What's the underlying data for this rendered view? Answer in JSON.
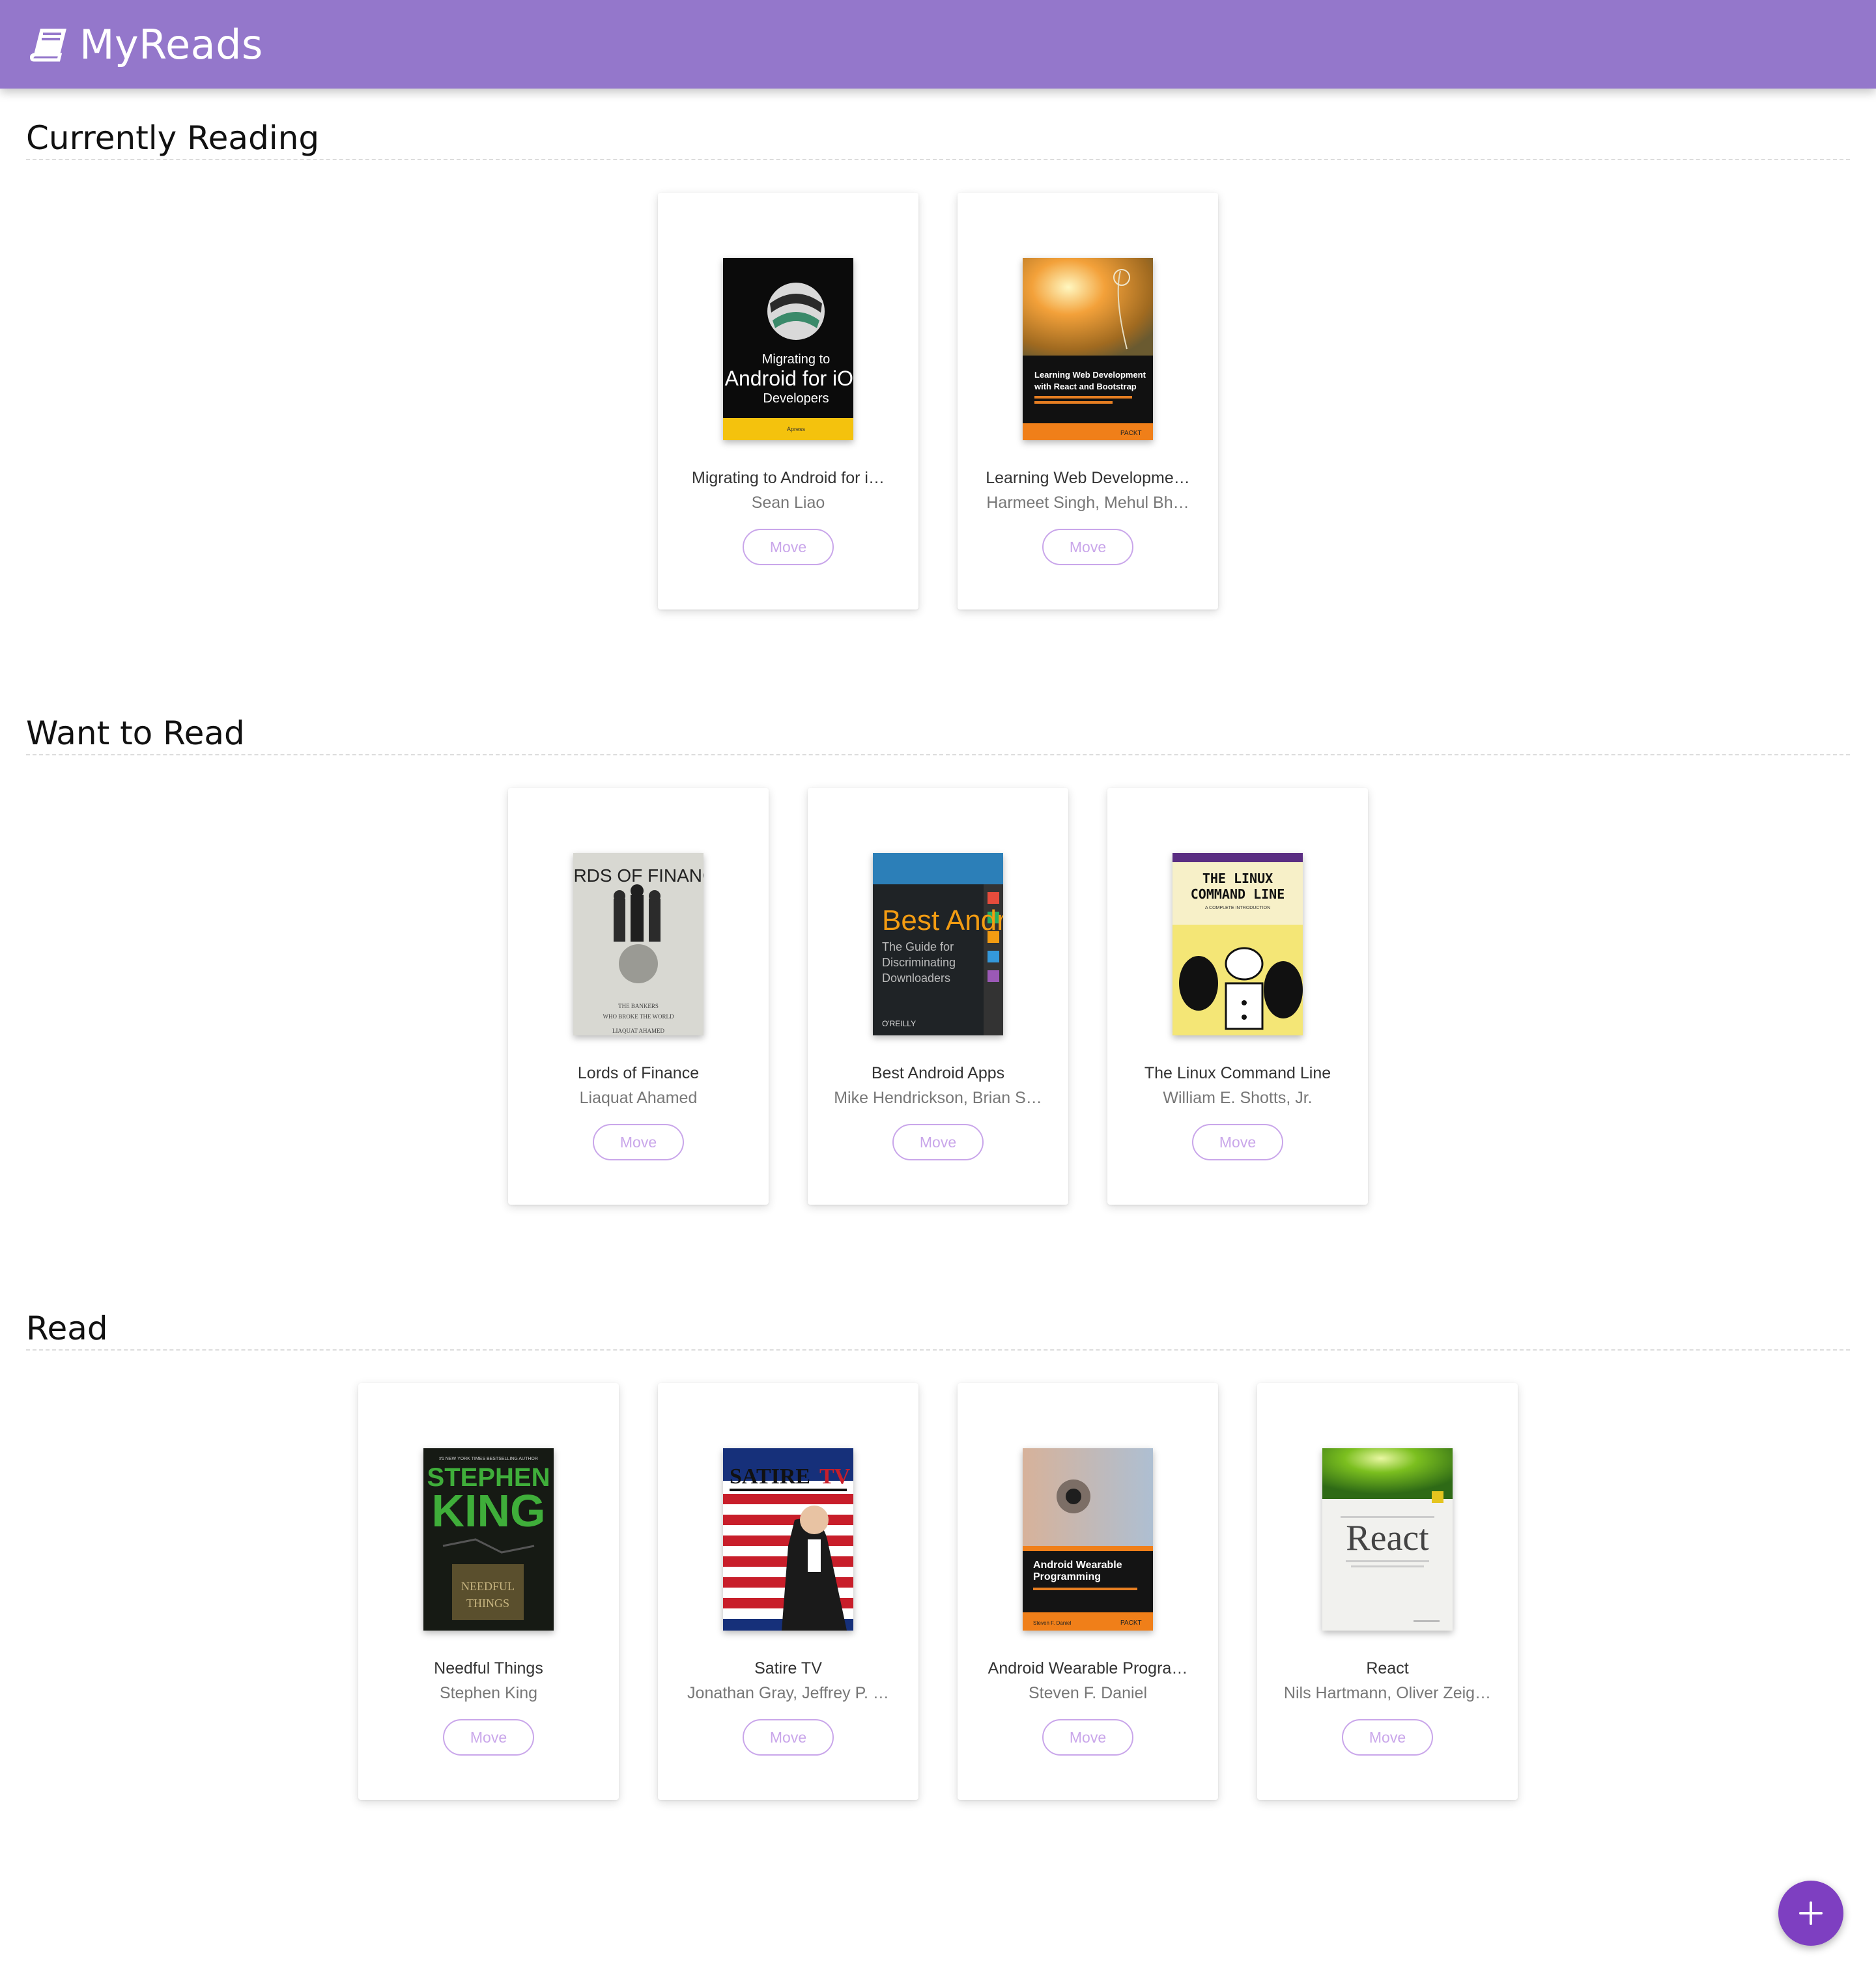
{
  "app": {
    "title": "MyReads",
    "logo_icon": "book-icon"
  },
  "colors": {
    "header": "#9477cb",
    "accent": "#7e3fc1",
    "move_button": "#c9a6ea"
  },
  "shelves": [
    {
      "title": "Currently Reading",
      "books": [
        {
          "title": "Migrating to Android for i…",
          "authors": "Sean Liao",
          "action": "Move"
        },
        {
          "title": "Learning Web Developme…",
          "authors": "Harmeet Singh, Mehul Bh…",
          "action": "Move"
        }
      ]
    },
    {
      "title": "Want to Read",
      "books": [
        {
          "title": "Lords of Finance",
          "authors": "Liaquat Ahamed",
          "action": "Move"
        },
        {
          "title": "Best Android Apps",
          "authors": "Mike Hendrickson, Brian S…",
          "action": "Move"
        },
        {
          "title": "The Linux Command Line",
          "authors": "William E. Shotts, Jr.",
          "action": "Move"
        }
      ]
    },
    {
      "title": "Read",
      "books": [
        {
          "title": "Needful Things",
          "authors": "Stephen King",
          "action": "Move"
        },
        {
          "title": "Satire TV",
          "authors": "Jonathan Gray, Jeffrey P. …",
          "action": "Move"
        },
        {
          "title": "Android Wearable Progra…",
          "authors": "Steven F. Daniel",
          "action": "Move"
        },
        {
          "title": "React",
          "authors": "Nils Hartmann, Oliver Zeig…",
          "action": "Move"
        }
      ]
    }
  ],
  "covers": {
    "c1": {
      "line1": "Migrating to",
      "line2": "Android for iOS",
      "line3": "Developers",
      "publisher": "Apress"
    },
    "c2": {
      "line1": "Learning Web Development",
      "line2": "with React and Bootstrap",
      "publisher": "PACKT"
    },
    "c3": {
      "line1": "LORDS OF FINANCE",
      "line2": "THE BANKERS",
      "line3": "WHO BROKE THE WORLD",
      "line4": "LIAQUAT AHAMED"
    },
    "c4": {
      "line1": "Best Andr",
      "line2": "The Guide for",
      "line3": "Discriminating",
      "line4": "Downloaders",
      "publisher": "O'REILLY"
    },
    "c5": {
      "line1": "THE LINUX",
      "line2": "COMMAND LINE",
      "line3": "A COMPLETE INTRODUCTION"
    },
    "c6": {
      "line0": "#1 NEW YORK TIMES BESTSELLING AUTHOR",
      "line1": "STEPHEN",
      "line2": "KING",
      "line3": "NEEDFUL",
      "line4": "THINGS"
    },
    "c7": {
      "line1": "SATIRE",
      "line2": "TV"
    },
    "c8": {
      "line1": "Android Wearable",
      "line2": "Programming",
      "line3": "Steven F. Daniel",
      "publisher": "PACKT"
    },
    "c9": {
      "line1": "React"
    }
  },
  "fab": {
    "icon": "plus-icon"
  }
}
